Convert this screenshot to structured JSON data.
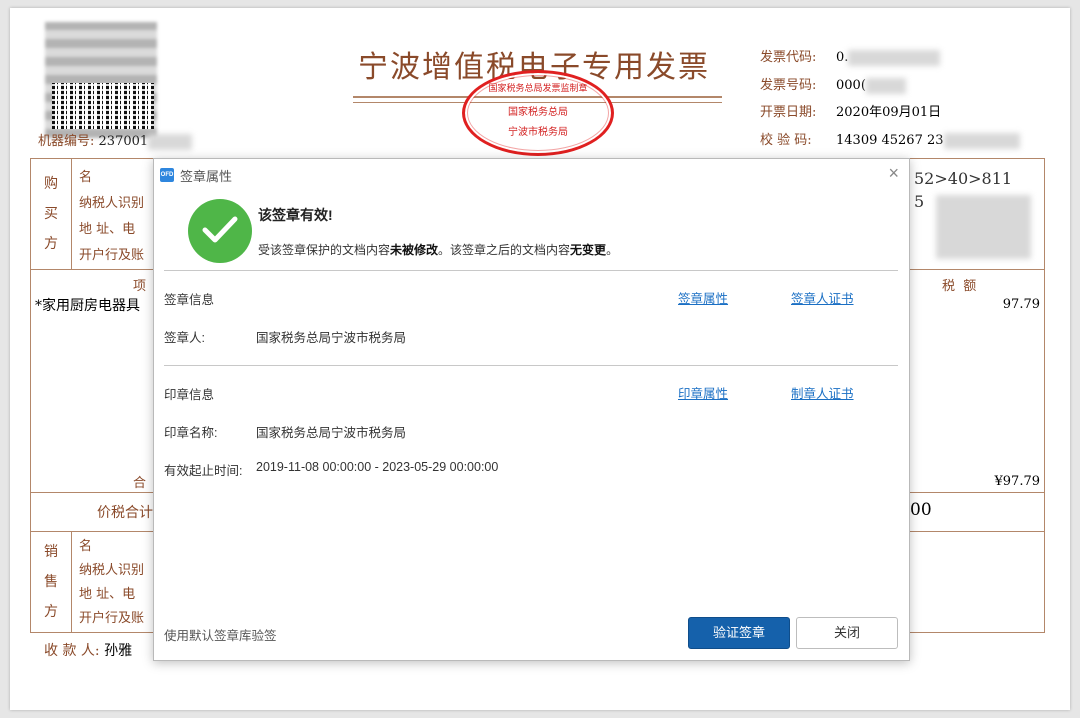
{
  "invoice": {
    "title": "宁波增值税电子专用发票",
    "machine_label": "机器编号:",
    "machine_value": "237001",
    "seal_outer": "国家税务总局发票监制章",
    "seal_middle": "国家税务总局",
    "seal_inner": "宁波市税务局",
    "meta": [
      {
        "label": "发票代码:",
        "value": "0."
      },
      {
        "label": "发票号码:",
        "value": "000("
      },
      {
        "label": "开票日期:",
        "value": "2020年09月01日"
      },
      {
        "label": "校 验 码:",
        "value": "14309 45267 23"
      }
    ],
    "buyer_vlabel": [
      "购",
      "买",
      "方"
    ],
    "buyer_rows": [
      "名",
      "纳税人识别",
      "地 址、电",
      "开户行及账"
    ],
    "cipher_text": "52>40>811",
    "cipher_tail": "5",
    "item_header": "项",
    "item_name": "*家用厨房电器具",
    "tax_header": "税  额",
    "tax_value": "97.79",
    "total_label": "合",
    "total_tax": "¥97.79",
    "price_total_label": "价税合计",
    "price_total_value": "00",
    "seller_vlabel": [
      "销",
      "售",
      "方"
    ],
    "seller_rows": [
      "名",
      "纳税人识别",
      "地 址、电",
      "开户行及账"
    ],
    "payee_label": "收 款 人:",
    "payee_value": "孙雅"
  },
  "dialog": {
    "app_icon": "OFD",
    "title": "签章属性",
    "close_icon": "×",
    "valid_title": "该签章有效!",
    "valid_desc_1": "受该签章保护的文档内容",
    "valid_desc_b1": "未被修改",
    "valid_desc_2": "。该签章之后的文档内容",
    "valid_desc_b2": "无变更",
    "valid_desc_3": "。",
    "signature_section": "签章信息",
    "signature_props_link": "签章属性",
    "signer_cert_link": "签章人证书",
    "signer_label": "签章人:",
    "signer_value": "国家税务总局宁波市税务局",
    "seal_section": "印章信息",
    "seal_props_link": "印章属性",
    "maker_cert_link": "制章人证书",
    "seal_name_label": "印章名称:",
    "seal_name_value": "国家税务总局宁波市税务局",
    "validity_label": "有效起止时间:",
    "validity_value": "2019-11-08 00:00:00 - 2023-05-29 00:00:00",
    "footer_note": "使用默认签章库验签",
    "verify_button": "验证签章",
    "close_button": "关闭"
  },
  "colors": {
    "accent": "#1561ab",
    "success": "#4fb648",
    "seal_red": "#e02020",
    "invoice_brown": "#8a4a2a"
  }
}
